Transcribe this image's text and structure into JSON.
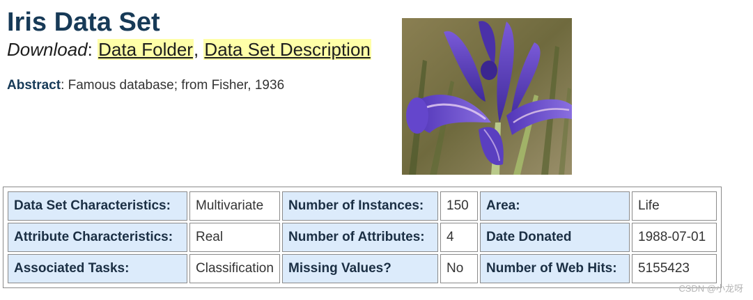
{
  "title": "Iris Data Set",
  "download": {
    "label": "Download",
    "separator": ":",
    "comma": ",",
    "links": [
      "Data Folder",
      "Data Set Description"
    ]
  },
  "abstract": {
    "label": "Abstract",
    "text": ": Famous database; from Fisher, 1936"
  },
  "image": {
    "subject": "purple iris flower photo",
    "colors": {
      "petal": "#5a3fc0",
      "background": "#7d7a4a"
    }
  },
  "table": {
    "rows": [
      [
        {
          "header": "Data Set Characteristics:",
          "value": "Multivariate"
        },
        {
          "header": "Number of Instances:",
          "value": "150"
        },
        {
          "header": "Area:",
          "value": "Life"
        }
      ],
      [
        {
          "header": "Attribute Characteristics:",
          "value": "Real"
        },
        {
          "header": "Number of Attributes:",
          "value": "4"
        },
        {
          "header": "Date Donated",
          "value": "1988-07-01"
        }
      ],
      [
        {
          "header": "Associated Tasks:",
          "value": "Classification"
        },
        {
          "header": "Missing Values?",
          "value": "No"
        },
        {
          "header": "Number of Web Hits:",
          "value": "5155423"
        }
      ]
    ]
  },
  "watermark": "CSDN @小龙呀",
  "colors": {
    "title": "#173a57",
    "link_highlight": "#ffffa8",
    "header_cell_bg": "#dcebfb",
    "border": "#8a8a8a"
  }
}
